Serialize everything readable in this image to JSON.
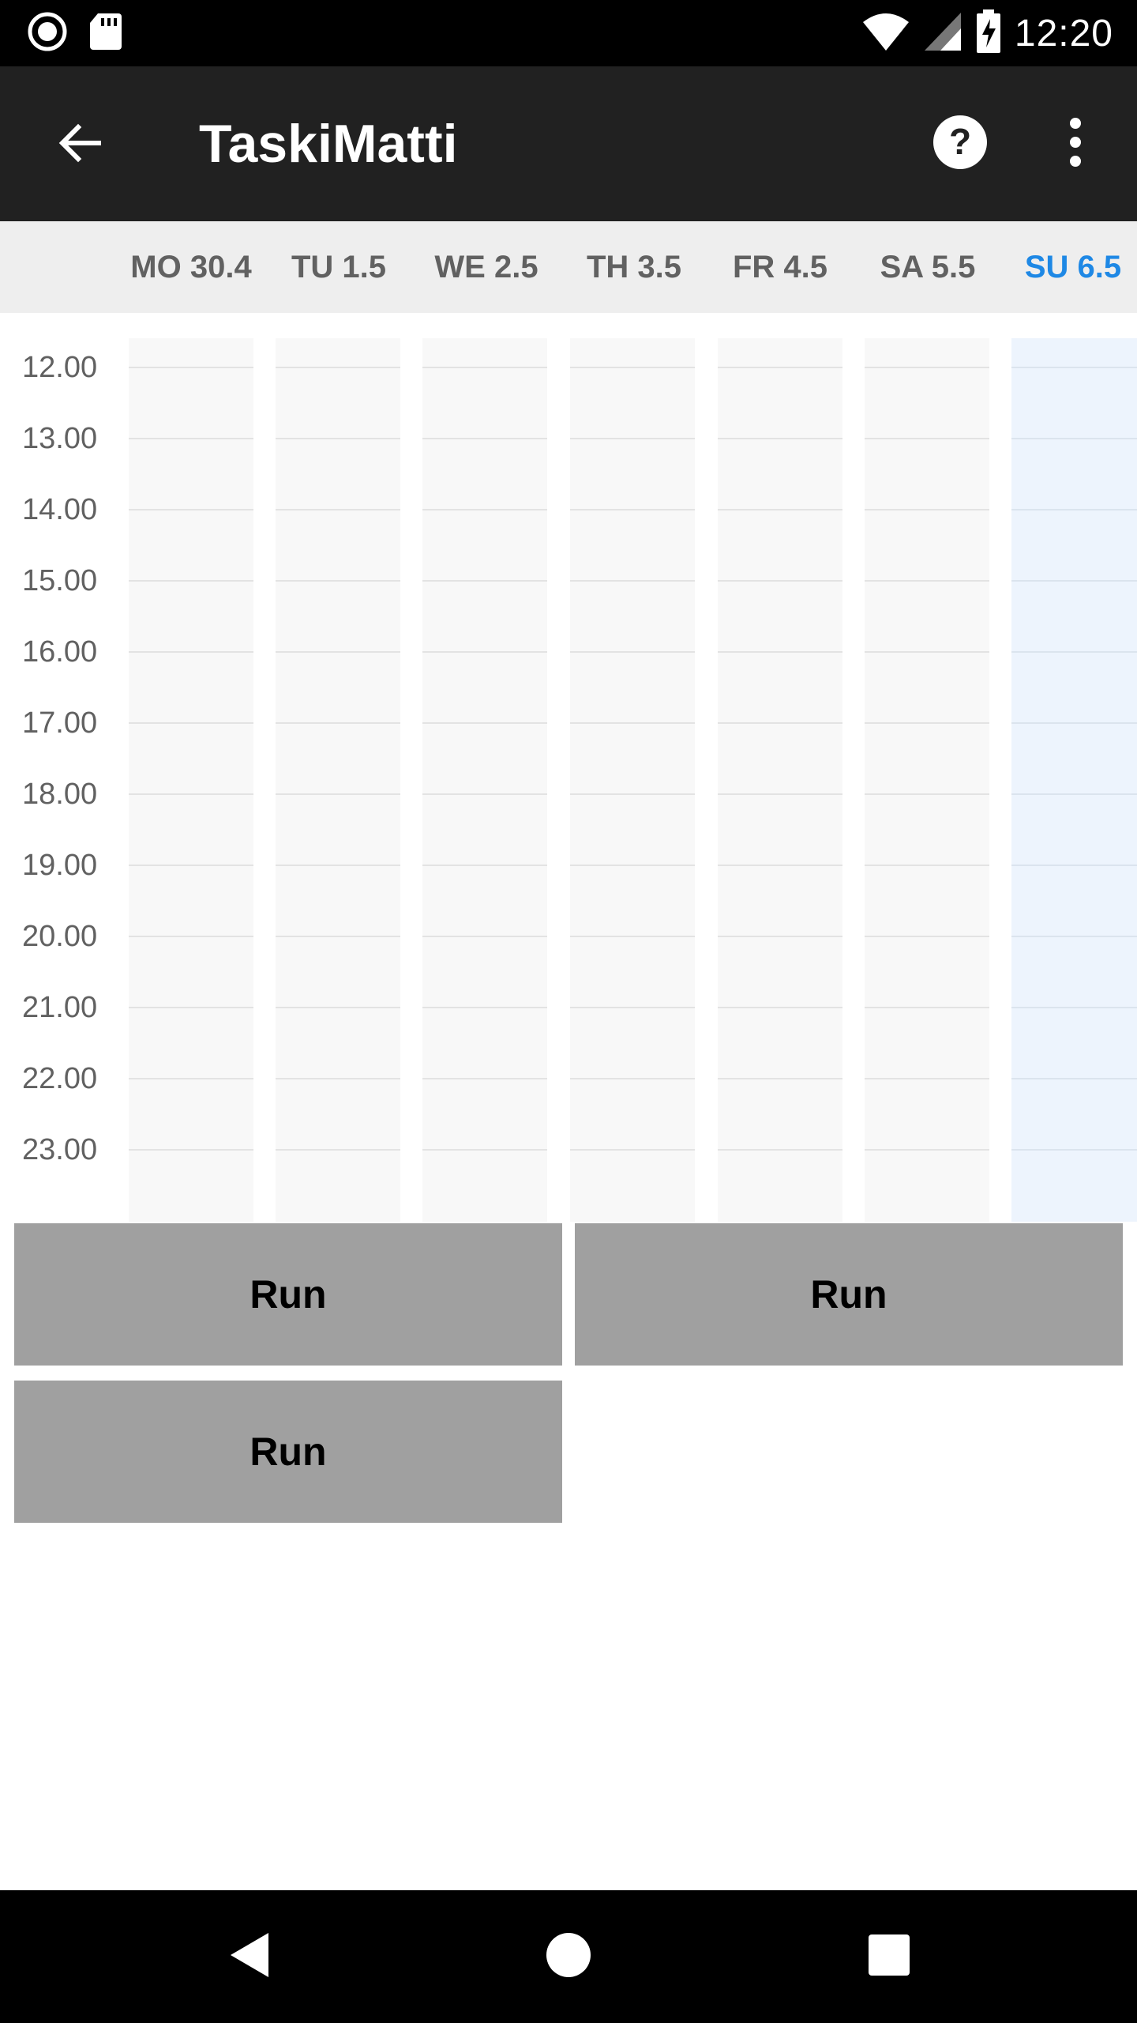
{
  "status_bar": {
    "time": "12:20",
    "icons": [
      "record-icon",
      "sd-card-icon",
      "wifi-icon",
      "signal-icon",
      "battery-charging-icon"
    ]
  },
  "app_bar": {
    "title": "TaskiMatti",
    "icons": [
      "back-arrow-icon",
      "help-icon",
      "more-vert-icon"
    ]
  },
  "days": [
    {
      "label": "MO 30.4",
      "today": false
    },
    {
      "label": "TU 1.5",
      "today": false
    },
    {
      "label": "WE 2.5",
      "today": false
    },
    {
      "label": "TH 3.5",
      "today": false
    },
    {
      "label": "FR 4.5",
      "today": false
    },
    {
      "label": "SA 5.5",
      "today": false
    },
    {
      "label": "SU 6.5",
      "today": true
    }
  ],
  "hours": [
    "12.00",
    "13.00",
    "14.00",
    "15.00",
    "16.00",
    "17.00",
    "18.00",
    "19.00",
    "20.00",
    "21.00",
    "22.00",
    "23.00"
  ],
  "buttons": {
    "run_1": "Run",
    "run_2": "Run",
    "run_3": "Run"
  },
  "colors": {
    "app_bar": "#212121",
    "today_accent": "#1e88e5",
    "run_button": "#a0a0a0"
  },
  "nav_bar": {
    "icons": [
      "back-triangle-icon",
      "home-circle-icon",
      "recents-square-icon"
    ]
  }
}
